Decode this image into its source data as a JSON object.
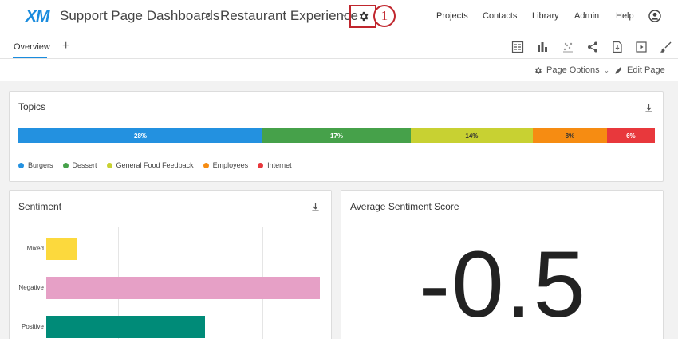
{
  "header": {
    "logo": "XM",
    "title": "Support Page Dashboards",
    "separator": ">",
    "subtitle": "Restaurant Experience",
    "caret": "⌄",
    "badge": "1",
    "nav": [
      "Projects",
      "Contacts",
      "Library",
      "Admin",
      "Help"
    ]
  },
  "tabs": {
    "overview": "Overview",
    "add": "+"
  },
  "toolbar_icons": [
    "filter-icon",
    "bar-chart-icon",
    "scatter-icon",
    "share-icon",
    "export-icon",
    "play-icon",
    "paintbrush-icon"
  ],
  "options": {
    "page_options": "Page Options",
    "page_options_caret": "⌄",
    "edit_page": "Edit Page"
  },
  "topics": {
    "title": "Topics",
    "segments": [
      {
        "name": "Burgers",
        "pct": 28,
        "label": "28%",
        "color": "#2391e0",
        "text_color": "#ffffff"
      },
      {
        "name": "Dessert",
        "pct": 17,
        "label": "17%",
        "color": "#46a14a",
        "text_color": "#ffffff"
      },
      {
        "name": "General Food Feedback",
        "pct": 14,
        "label": "14%",
        "color": "#c8d132",
        "text_color": "#333333"
      },
      {
        "name": "Employees",
        "pct": 8.5,
        "label": "8%",
        "color": "#f68c12",
        "text_color": "#333333"
      },
      {
        "name": "Internet",
        "pct": 5.5,
        "label": "6%",
        "color": "#e8383c",
        "text_color": "#ffffff"
      }
    ]
  },
  "sentiment": {
    "title": "Sentiment",
    "bars": [
      {
        "label": "Mixed",
        "value": 11,
        "color": "#fcd93d"
      },
      {
        "label": "Negative",
        "value": 100,
        "color": "#e6a0c6"
      },
      {
        "label": "Positive",
        "value": 58,
        "color": "#008b78"
      }
    ]
  },
  "avg_score": {
    "title": "Average Sentiment Score",
    "value": "-0.5"
  }
}
